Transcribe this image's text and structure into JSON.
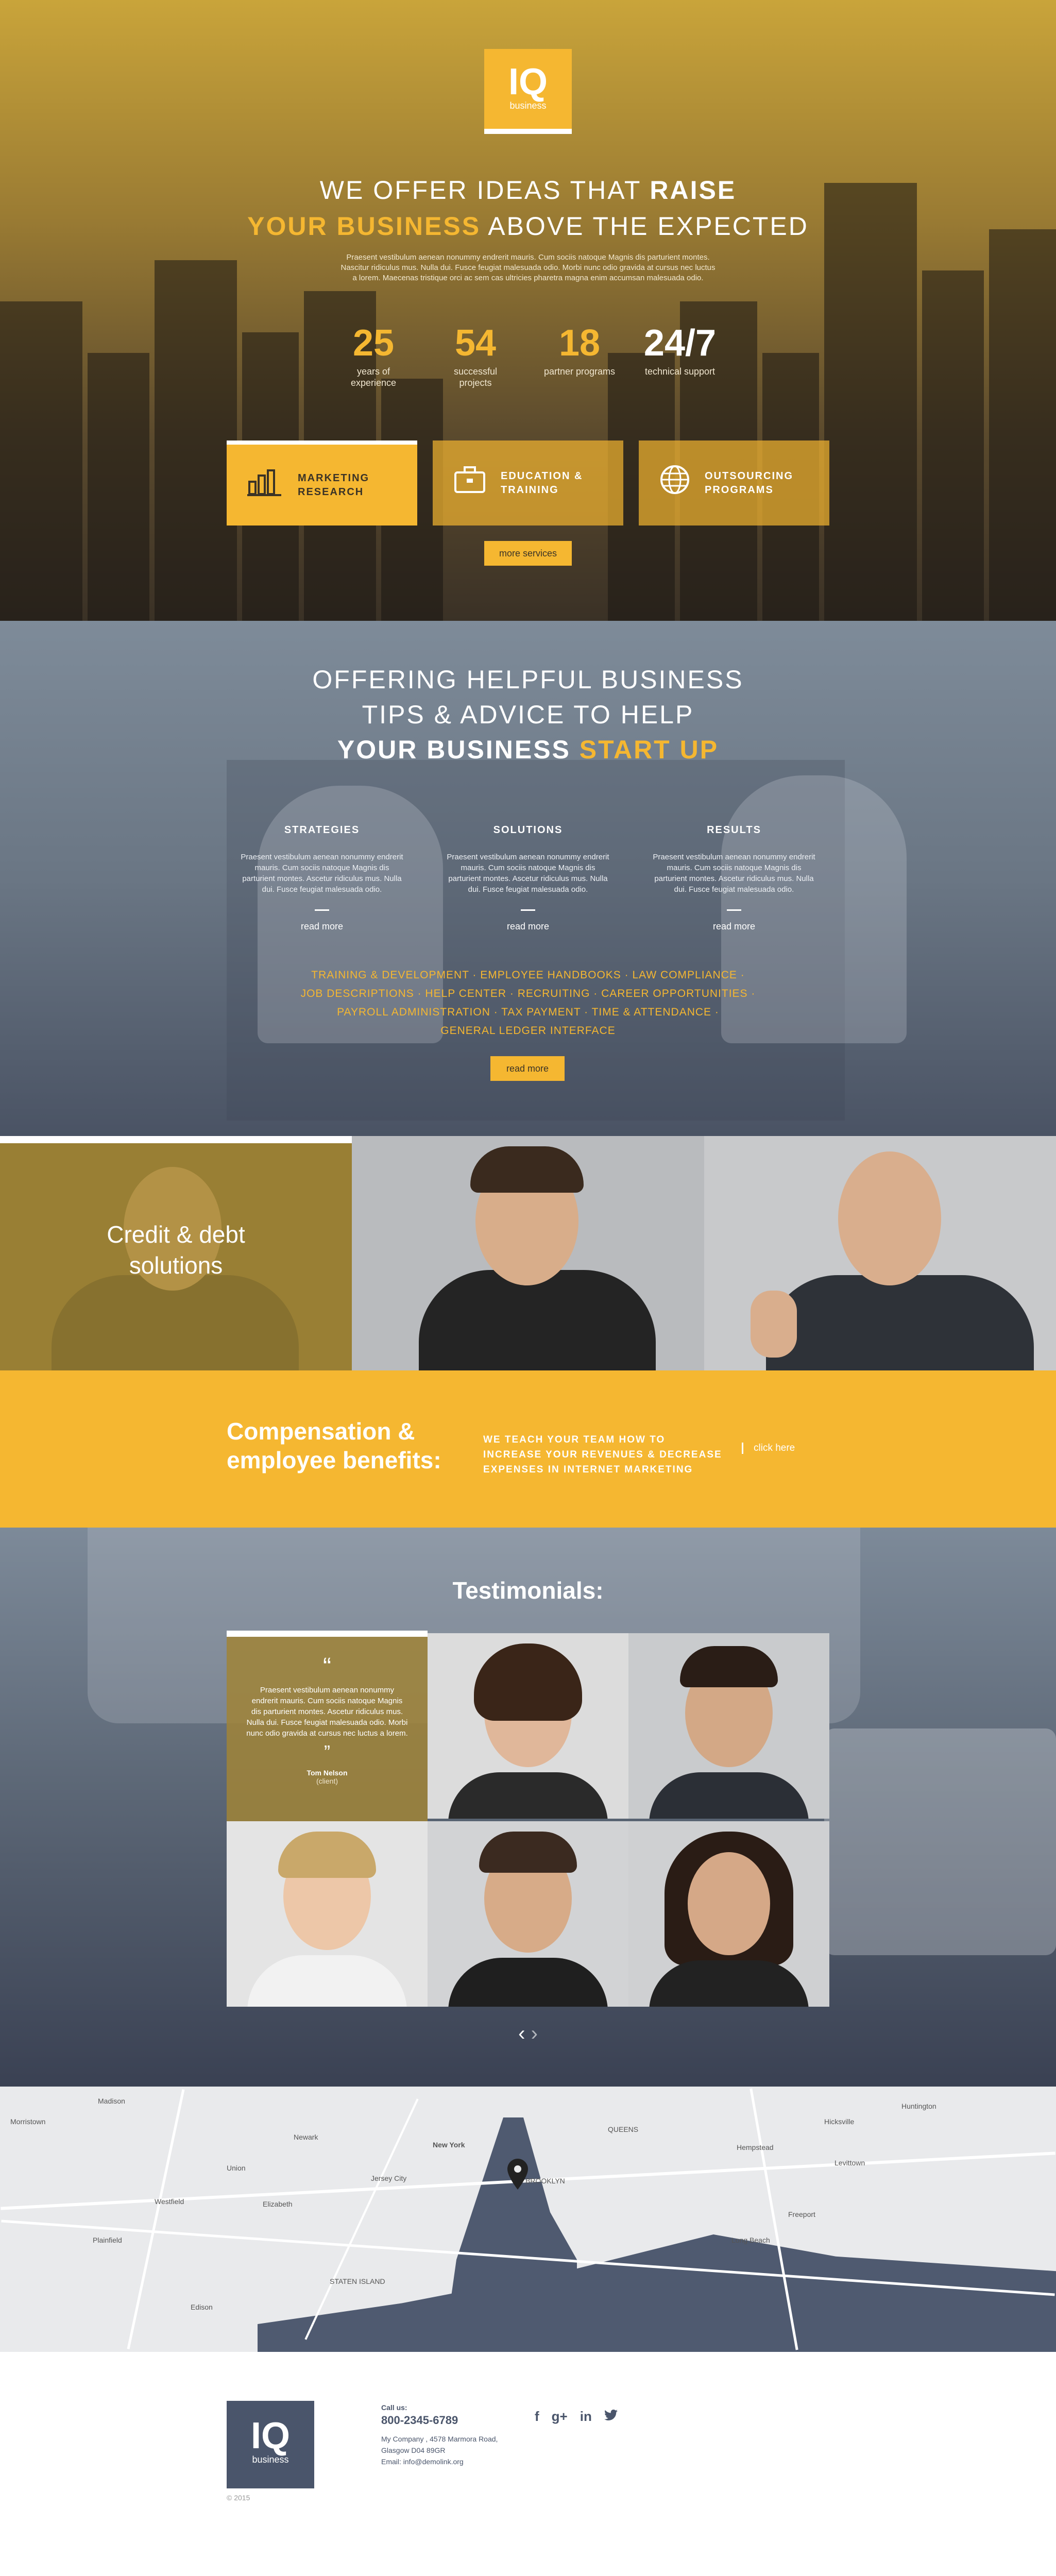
{
  "hero": {
    "logo": {
      "mark": "IQ",
      "sub": "business"
    },
    "headline_line1_pre": "WE OFFER IDEAS THAT ",
    "headline_line1_bold": "RAISE",
    "headline_line2_accent": "YOUR BUSINESS",
    "headline_line2_post": " ABOVE THE EXPECTED",
    "intro": "Praesent vestibulum aenean nonummy endrerit mauris. Cum sociis natoque Magnis dis parturient montes. Nascitur ridiculus mus. Nulla dui. Fusce feugiat malesuada odio. Morbi nunc odio gravida at cursus nec luctus a lorem. Maecenas tristique orci ac sem cas ultricies pharetra magna enim accumsan malesuada odio.",
    "stats": [
      {
        "value": "25",
        "label": "years of experience"
      },
      {
        "value": "54",
        "label": "successful projects"
      },
      {
        "value": "18",
        "label": "partner programs"
      },
      {
        "value": "24/7",
        "label": "technical support"
      }
    ],
    "services": [
      {
        "icon": "bar-chart-icon",
        "label": "MARKETING RESEARCH"
      },
      {
        "icon": "briefcase-icon",
        "label": "EDUCATION & TRAINING"
      },
      {
        "icon": "globe-icon",
        "label": "OUTSOURCING PROGRAMS"
      }
    ],
    "more_button": "more services"
  },
  "advice": {
    "line1": "OFFERING HELPFUL BUSINESS",
    "line2": "TIPS & ADVICE TO HELP",
    "line3_bold": "YOUR BUSINESS ",
    "line3_accent": "START UP",
    "columns": [
      {
        "title": "STRATEGIES",
        "text": "Praesent vestibulum aenean nonummy endrerit mauris. Cum sociis natoque Magnis dis parturient montes. Ascetur ridiculus mus. Nulla dui. Fusce feugiat malesuada odio.",
        "link": "read more"
      },
      {
        "title": "SOLUTIONS",
        "text": "Praesent vestibulum aenean nonummy endrerit mauris. Cum sociis natoque Magnis dis parturient montes. Ascetur ridiculus mus. Nulla dui. Fusce feugiat malesuada odio.",
        "link": "read more"
      },
      {
        "title": "RESULTS",
        "text": "Praesent vestibulum aenean nonummy endrerit mauris. Cum sociis natoque Magnis dis parturient montes. Ascetur ridiculus mus. Nulla dui. Fusce feugiat malesuada odio.",
        "link": "read more"
      }
    ],
    "links_row1": "TRAINING & DEVELOPMENT  ·  EMPLOYEE HANDBOOKS  ·  LAW COMPLIANCE  ·",
    "links_row2": "JOB DESCRIPTIONS  ·  HELP CENTER  ·  RECRUITING  ·  CAREER OPPORTUNITIES  ·",
    "links_row3": "PAYROLL ADMINISTRATION  ·  TAX PAYMENT  ·  TIME & ATTENDANCE  ·",
    "links_row4": "GENERAL LEDGER INTERFACE",
    "button": "read more"
  },
  "strip": {
    "credit_line1": "Credit & debt",
    "credit_line2": "solutions"
  },
  "compensation": {
    "title_line1": "Compensation &",
    "title_line2": "employee benefits:",
    "text_line1": "WE TEACH YOUR TEAM HOW TO",
    "text_line2": "INCREASE YOUR REVENUES & DECREASE",
    "text_line3": "EXPENSES IN INTERNET MARKETING",
    "link": "click here"
  },
  "testimonials": {
    "title": "Testimonials:",
    "quote": "Praesent vestibulum aenean nonummy endrerit mauris. Cum sociis natoque Magnis dis parturient montes. Ascetur ridiculus mus. Nulla dui. Fusce feugiat malesuada odio. Morbi nunc odio gravida at cursus nec luctus a lorem.",
    "name": "Tom Nelson",
    "role": "(client)",
    "arrows": "‹ ›"
  },
  "map": {
    "labels": [
      "Madison",
      "Newark",
      "Jersey City",
      "New York",
      "QUEENS",
      "BROOKLYN",
      "Westfield",
      "Elizabeth",
      "STATEN ISLAND",
      "Hempstead",
      "Freeport",
      "Long Beach",
      "Levittown",
      "Hicksville",
      "Huntington",
      "Morristown",
      "Plainfield",
      "Edison",
      "Union"
    ]
  },
  "footer": {
    "logo": {
      "mark": "IQ",
      "sub": "business"
    },
    "call_label": "Call us:",
    "phone": "800-2345-6789",
    "address1": "My Company , 4578 Marmora Road,",
    "address2": "Glasgow D04 89GR",
    "email": "Email: info@demolink.org",
    "copyright": "© 2015",
    "social": [
      "f",
      "g+",
      "in",
      "t"
    ]
  },
  "colors": {
    "accent": "#f5b731",
    "slate": "#4a556b"
  }
}
